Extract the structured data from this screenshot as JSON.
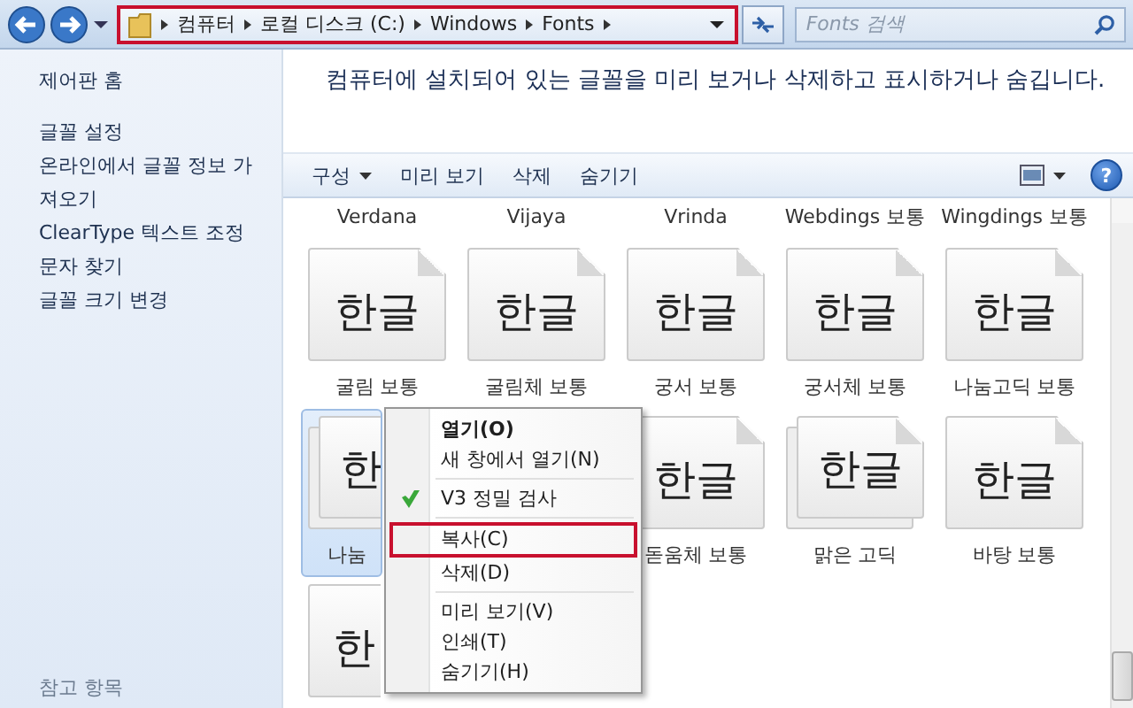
{
  "address_bar": {
    "crumbs": [
      "컴퓨터",
      "로컬 디스크 (C:)",
      "Windows",
      "Fonts"
    ],
    "highlighted": true
  },
  "search": {
    "placeholder": "Fonts 검색"
  },
  "sidebar": {
    "items": [
      {
        "label": "제어판 홈",
        "kind": "home"
      },
      {
        "label": "글꼴 설정",
        "kind": "task"
      },
      {
        "label": "온라인에서 글꼴 정보 가져오기",
        "kind": "task"
      },
      {
        "label": "ClearType 텍스트 조정",
        "kind": "task"
      },
      {
        "label": "문자 찾기",
        "kind": "task"
      },
      {
        "label": "글꼴 크기 변경",
        "kind": "task"
      }
    ],
    "see_also": "참고 항목"
  },
  "header": "컴퓨터에 설치되어 있는 글꼴을 미리 보거나 삭제하고 표시하거나 숨깁니다.",
  "toolbar": {
    "buttons": [
      {
        "label": "구성",
        "dropdown": true
      },
      {
        "label": "미리 보기",
        "dropdown": false
      },
      {
        "label": "삭제",
        "dropdown": false
      },
      {
        "label": "숨기기",
        "dropdown": false
      }
    ],
    "help": "?"
  },
  "fonts": [
    {
      "kind": "caption",
      "label": "Verdana"
    },
    {
      "kind": "caption",
      "label": "Vijaya"
    },
    {
      "kind": "caption",
      "label": "Vrinda"
    },
    {
      "kind": "caption",
      "label": "Webdings 보통"
    },
    {
      "kind": "caption",
      "label": "Wingdings 보통"
    },
    {
      "kind": "tile",
      "glyph": "한글",
      "label": "굴림 보통",
      "selected": false,
      "stacked": false
    },
    {
      "kind": "tile",
      "glyph": "한글",
      "label": "굴림체 보통",
      "selected": false,
      "stacked": false
    },
    {
      "kind": "tile",
      "glyph": "한글",
      "label": "궁서 보통",
      "selected": false,
      "stacked": false
    },
    {
      "kind": "tile",
      "glyph": "한글",
      "label": "궁서체 보통",
      "selected": false,
      "stacked": false
    },
    {
      "kind": "tile",
      "glyph": "한글",
      "label": "나눔고딕 보통",
      "selected": false,
      "stacked": false
    },
    {
      "kind": "cut-tile",
      "glyph": "한",
      "label": "나눔",
      "selected": true,
      "stacked": true
    },
    {
      "kind": "covered"
    },
    {
      "kind": "tile",
      "glyph": "한글",
      "label": "돋움체 보통",
      "selected": false,
      "stacked": false
    },
    {
      "kind": "tile",
      "glyph": "한글",
      "label": "맑은 고딕",
      "selected": false,
      "stacked": true
    },
    {
      "kind": "tile",
      "glyph": "한글",
      "label": "바탕 보통",
      "selected": false,
      "stacked": false
    },
    {
      "kind": "cut-tile",
      "glyph": "한",
      "selected": false,
      "stacked": false
    }
  ],
  "context_menu": {
    "items": [
      {
        "kind": "item",
        "label": "열기(O)",
        "default": true,
        "highlighted": false
      },
      {
        "kind": "item",
        "label": "새 창에서 열기(N)",
        "default": false,
        "highlighted": false
      },
      {
        "kind": "separator"
      },
      {
        "kind": "scan",
        "label": "V3 정밀 검사",
        "default": false,
        "highlighted": false
      },
      {
        "kind": "separator"
      },
      {
        "kind": "item",
        "label": "복사(C)",
        "default": false,
        "highlighted": true
      },
      {
        "kind": "item",
        "label": "삭제(D)",
        "default": false,
        "highlighted": false
      },
      {
        "kind": "separator"
      },
      {
        "kind": "item",
        "label": "미리 보기(V)",
        "default": false,
        "highlighted": false
      },
      {
        "kind": "item",
        "label": "인쇄(T)",
        "default": false,
        "highlighted": false
      },
      {
        "kind": "item",
        "label": "숨기기(H)",
        "default": false,
        "highlighted": false
      }
    ]
  }
}
